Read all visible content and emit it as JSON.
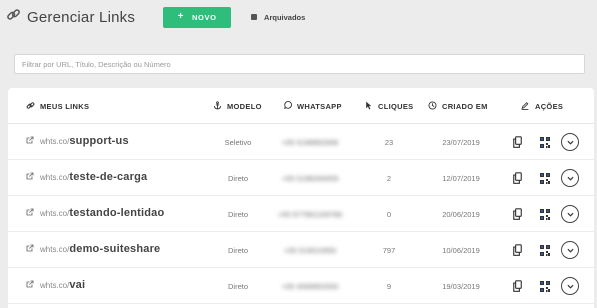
{
  "header": {
    "title": "Gerenciar Links",
    "new_button": "NOVO",
    "archived": "Arquivados"
  },
  "filter": {
    "placeholder": "Filtrar por URL, Título, Descrição ou Número"
  },
  "table": {
    "columns": {
      "links": "MEUS LINKS",
      "modelo": "MODELO",
      "whatsapp": "WHATSAPP",
      "cliques": "CLIQUES",
      "criado": "CRIADO EM",
      "acoes": "AÇÕES"
    },
    "rows": [
      {
        "domain": "whts.co/",
        "slug": "support-us",
        "modelo": "Seletivo",
        "whatsapp": "+55 5198892696",
        "cliques": "23",
        "criado": "23/07/2019"
      },
      {
        "domain": "whts.co/",
        "slug": "teste-de-carga",
        "modelo": "Direto",
        "whatsapp": "+55 5198269459",
        "cliques": "2",
        "criado": "12/07/2019"
      },
      {
        "domain": "whts.co/",
        "slug": "testando-lentidao",
        "modelo": "Direto",
        "whatsapp": "+55 977961169786",
        "cliques": "0",
        "criado": "20/06/2019"
      },
      {
        "domain": "whts.co/",
        "slug": "demo-suiteshare",
        "modelo": "Direto",
        "whatsapp": "+55 519010950",
        "cliques": "797",
        "criado": "10/06/2019"
      },
      {
        "domain": "whts.co/",
        "slug": "vai",
        "modelo": "Direto",
        "whatsapp": "+55 4599952000",
        "cliques": "9",
        "criado": "19/03/2019"
      }
    ]
  },
  "icons": {
    "title": "link-icon",
    "row_link": "external-link-icon",
    "copy": "copy-icon",
    "qr": "qr-code-icon",
    "more": "chevron-down-circle-icon"
  },
  "colors": {
    "accent": "#2ebd7a",
    "background": "#ececec"
  }
}
